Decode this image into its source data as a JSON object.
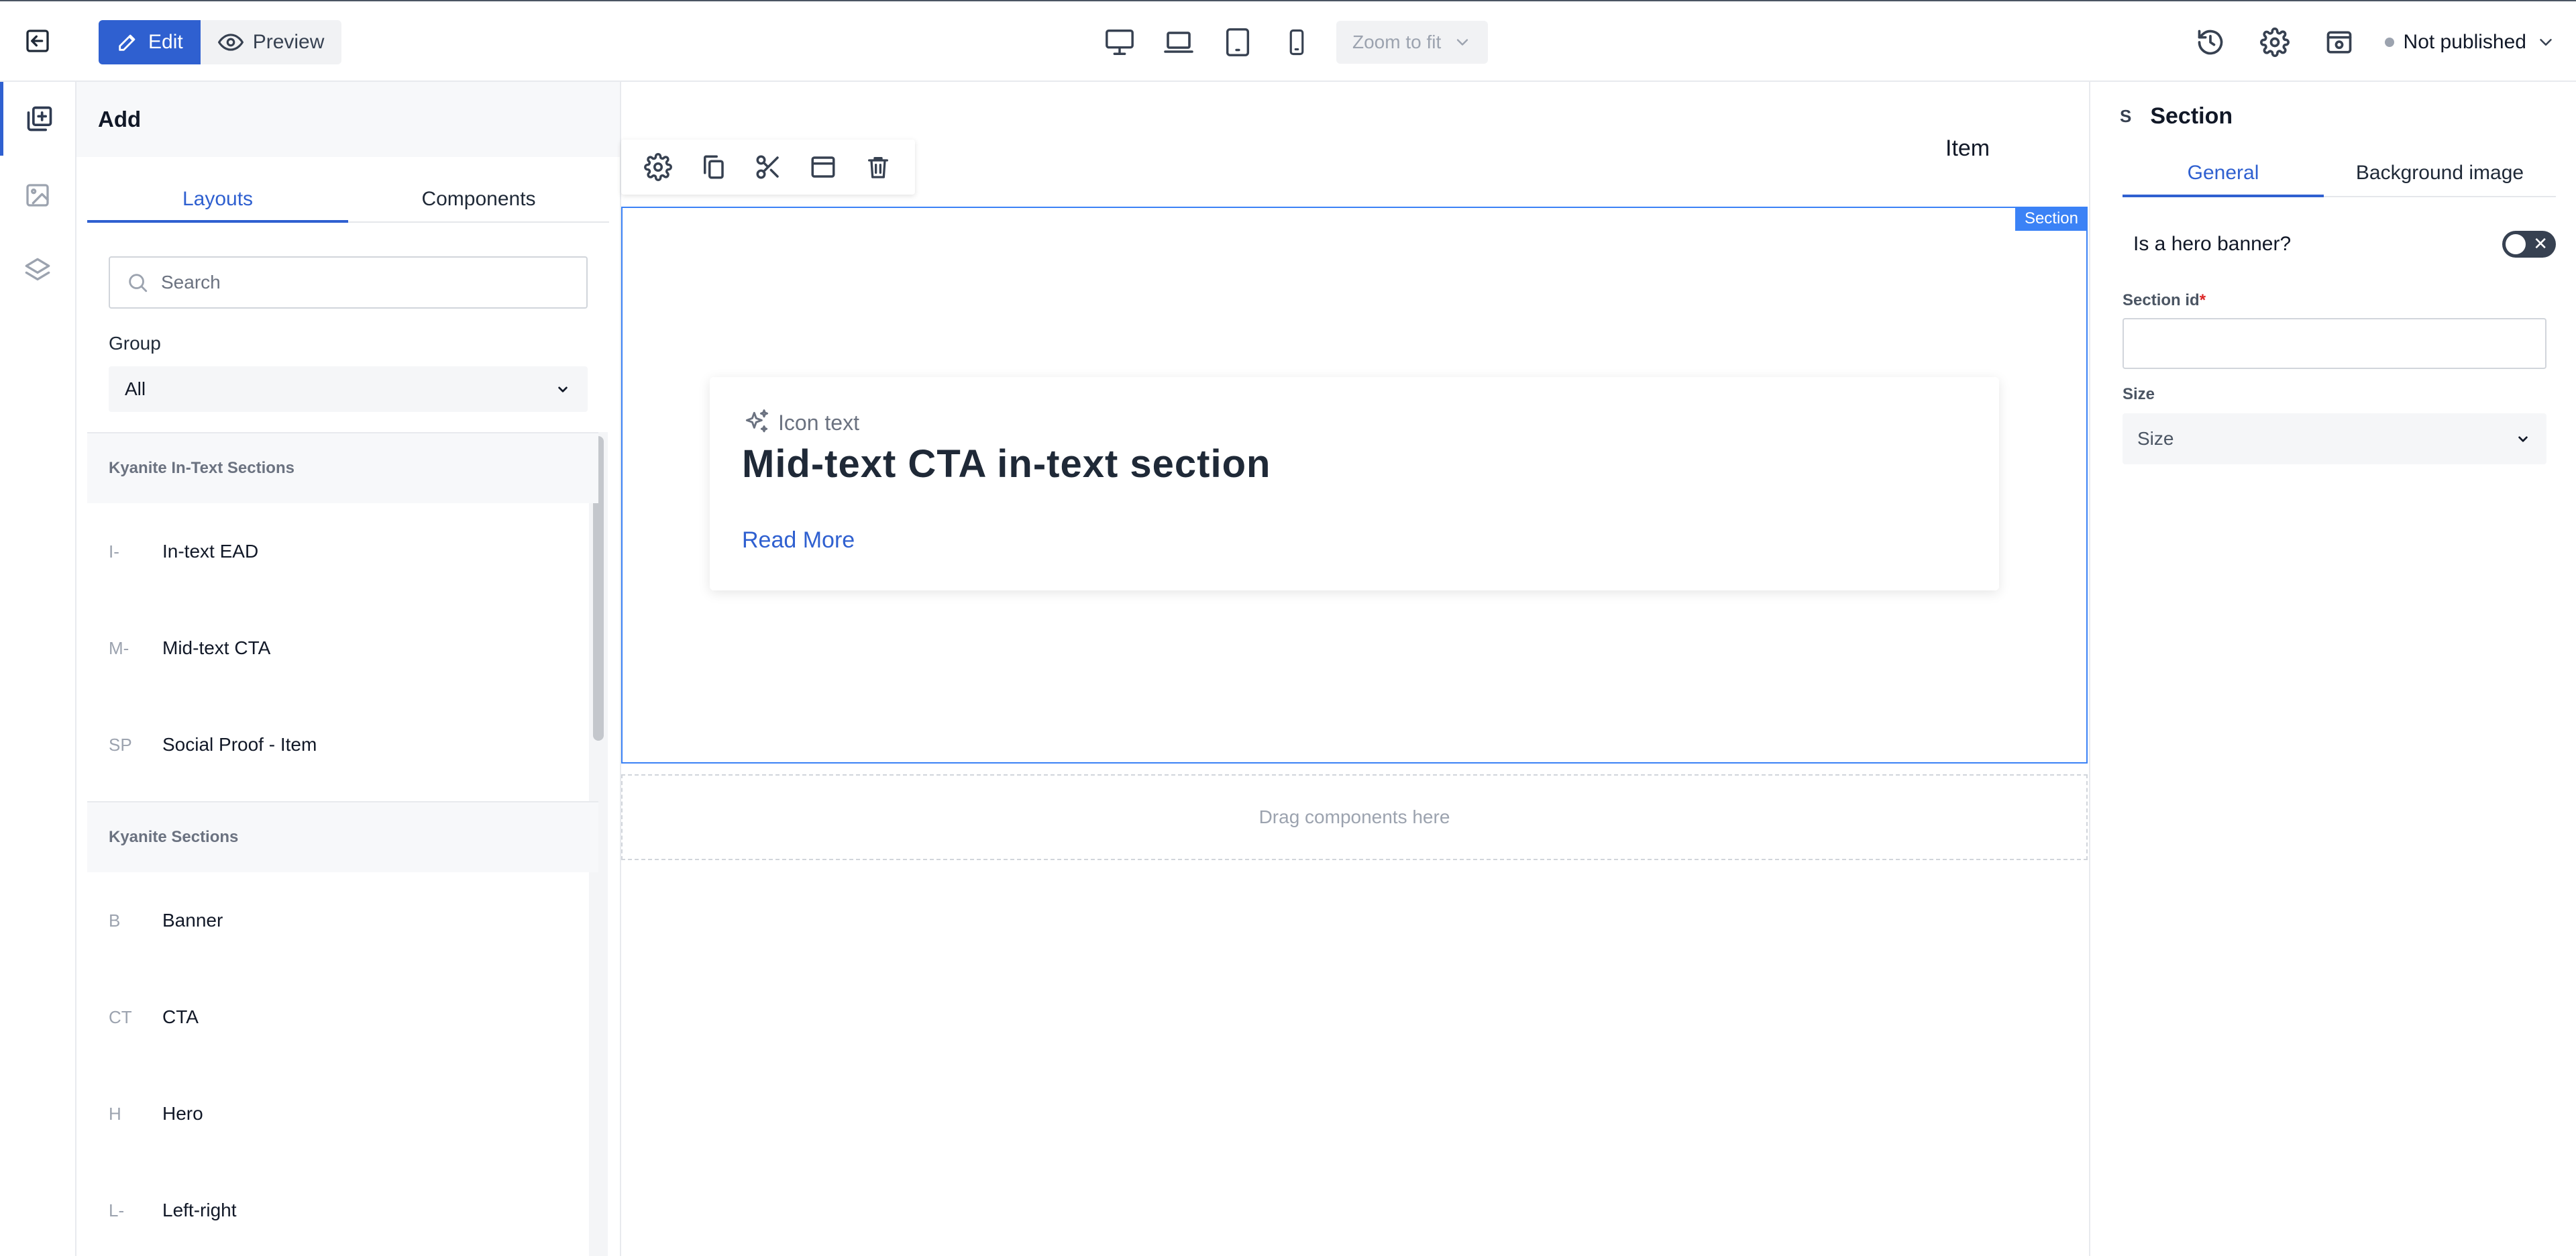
{
  "topbar": {
    "edit_label": "Edit",
    "preview_label": "Preview",
    "zoom_label": "Zoom to fit",
    "publish_status": "Not published"
  },
  "icons": {
    "exit": "exit-icon",
    "edit": "pencil-icon",
    "preview": "eye-icon",
    "desktop": "desktop-icon",
    "laptop": "laptop-icon",
    "tablet": "tablet-icon",
    "mobile": "mobile-icon",
    "history": "history-icon",
    "settings": "gear-icon",
    "preview_window": "preview-window-icon"
  },
  "rail": [
    "add-block-icon",
    "image-icon",
    "layers-icon"
  ],
  "left_panel": {
    "title": "Add",
    "tabs": [
      {
        "label": "Layouts",
        "active": true
      },
      {
        "label": "Components",
        "active": false
      }
    ],
    "search_placeholder": "Search",
    "group_label": "Group",
    "group_value": "All",
    "sections": [
      {
        "title": "Kyanite In-Text Sections",
        "items": [
          {
            "abbr": "I-",
            "label": "In-text EAD"
          },
          {
            "abbr": "M-",
            "label": "Mid-text CTA"
          },
          {
            "abbr": "SP",
            "label": "Social Proof - Item"
          }
        ]
      },
      {
        "title": "Kyanite Sections",
        "items": [
          {
            "abbr": "B",
            "label": "Banner"
          },
          {
            "abbr": "CT",
            "label": "CTA"
          },
          {
            "abbr": "H",
            "label": "Hero"
          },
          {
            "abbr": "L-",
            "label": "Left-right"
          }
        ]
      }
    ]
  },
  "canvas": {
    "nav_item": "Item",
    "section_tag": "Section",
    "cta": {
      "icon_text": "Icon text",
      "title": "Mid-text CTA in-text section",
      "link": "Read More"
    },
    "drop_zone": "Drag components here"
  },
  "right_panel": {
    "abbr": "S",
    "title": "Section",
    "tabs": [
      {
        "label": "General",
        "active": true
      },
      {
        "label": "Background image",
        "active": false
      }
    ],
    "hero_label": "Is a hero banner?",
    "hero_value": false,
    "section_id_label": "Section id",
    "required_mark": "*",
    "section_id_value": "",
    "size_label": "Size",
    "size_value": "Size"
  },
  "colors": {
    "accent": "#2f60d0",
    "section_outline": "#3b82f6",
    "required": "#dc2626"
  }
}
